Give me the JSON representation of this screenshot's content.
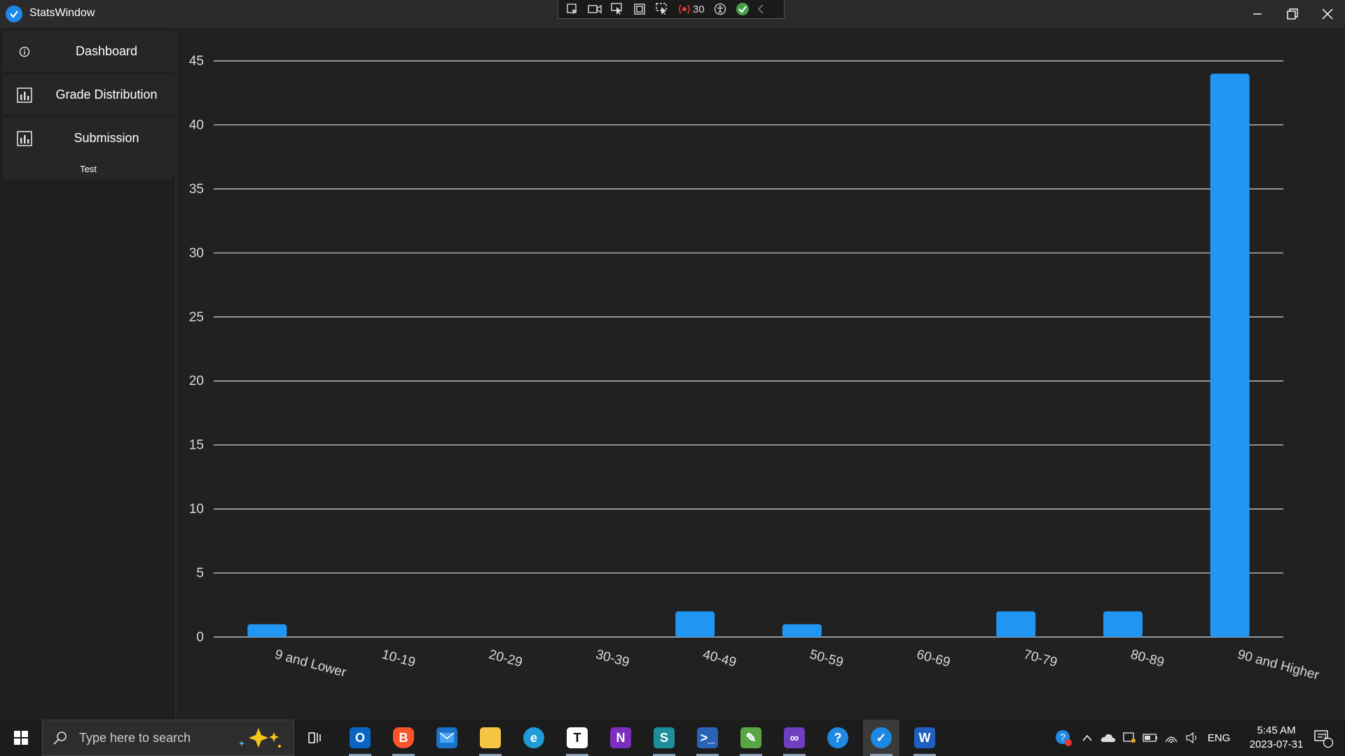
{
  "window": {
    "title": "StatsWindow"
  },
  "devtools": {
    "counter": "30"
  },
  "sidebar": {
    "items": [
      {
        "label": "Dashboard",
        "icon": "info-icon"
      },
      {
        "label": "Grade Distribution",
        "icon": "bar-chart-icon"
      },
      {
        "label": "Submission",
        "icon": "bar-chart-icon"
      }
    ],
    "subitem": "Test"
  },
  "chart_data": {
    "type": "bar",
    "categories": [
      "9 and Lower",
      "10-19",
      "20-29",
      "30-39",
      "40-49",
      "50-59",
      "60-69",
      "70-79",
      "80-89",
      "90 and Higher"
    ],
    "values": [
      1,
      0,
      0,
      0,
      2,
      1,
      0,
      2,
      2,
      44
    ],
    "ylim": [
      0,
      45
    ],
    "yticks": [
      0,
      5,
      10,
      15,
      20,
      25,
      30,
      35,
      40,
      45
    ],
    "bar_color": "#2196f3",
    "grid": true
  },
  "taskbar": {
    "search_placeholder": "Type here to search",
    "apps": [
      "Outlook",
      "Brave",
      "Mail",
      "File Explorer",
      "Edge",
      "Typora",
      "OneNote",
      "Sketch tool",
      "PowerShell",
      "Notepad",
      "Visual Studio",
      "Help",
      "StatsWindow",
      "Word"
    ],
    "language": "ENG",
    "time": "5:45 AM",
    "date": "2023-07-31",
    "notification_count": "1"
  },
  "colors": {
    "accent": "#2196f3",
    "background": "#202020",
    "sidebar": "#262626"
  }
}
